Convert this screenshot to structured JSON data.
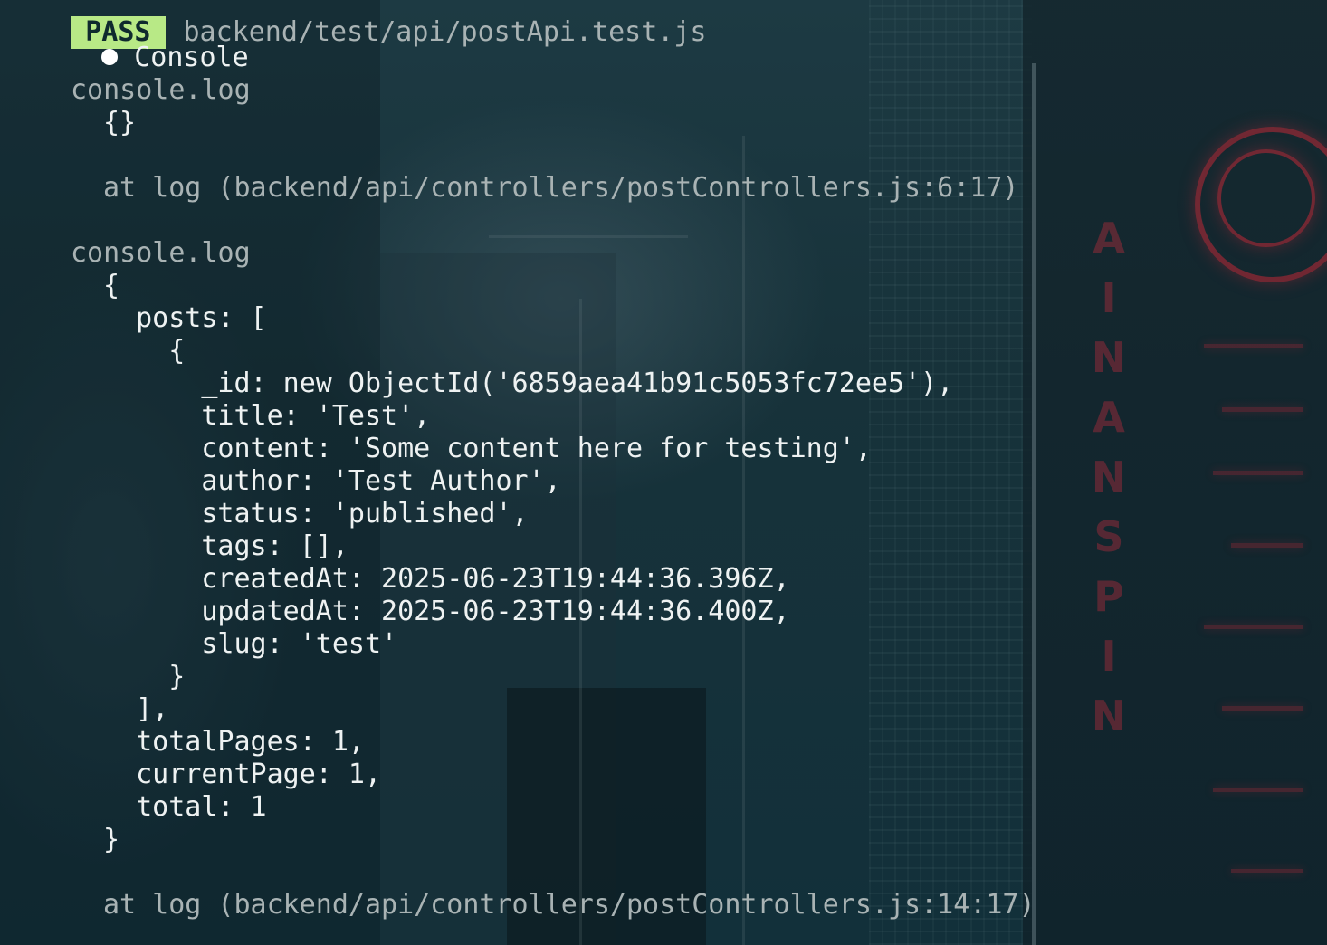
{
  "status": {
    "badge": "PASS",
    "test_file": "backend/test/api/postApi.test.js"
  },
  "section_title": "Console",
  "entries": [
    {
      "label": "console.log",
      "lines": [
        "{}"
      ],
      "location": "at log (backend/api/controllers/postControllers.js:6:17)"
    },
    {
      "label": "console.log",
      "lines": [
        "{",
        "  posts: [",
        "    {",
        "      _id: new ObjectId('6859aea41b91c5053fc72ee5'),",
        "      title: 'Test',",
        "      content: 'Some content here for testing',",
        "      author: 'Test Author',",
        "      status: 'published',",
        "      tags: [],",
        "      createdAt: 2025-06-23T19:44:36.396Z,",
        "      updatedAt: 2025-06-23T19:44:36.400Z,",
        "      slug: 'test'",
        "    }",
        "  ],",
        "  totalPages: 1,",
        "  currentPage: 1,",
        "  total: 1",
        "}"
      ],
      "location": "at log (backend/api/controllers/postControllers.js:14:17)"
    }
  ],
  "colors": {
    "text": "#eef2f2",
    "dim_text": "#a9b3b4",
    "pass_badge": "#b8e986",
    "background": "#1b3138"
  }
}
